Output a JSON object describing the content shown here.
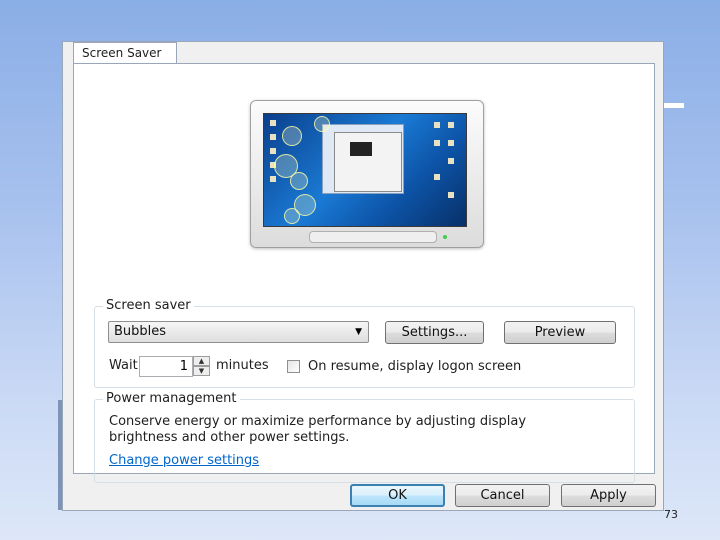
{
  "tab": {
    "label": "Screen Saver"
  },
  "screen_saver": {
    "group_title": "Screen saver",
    "selected": "Bubbles",
    "settings_label": "Settings...",
    "preview_label": "Preview",
    "wait_label": "Wait:",
    "wait_value": "1",
    "minutes_label": "minutes",
    "resume_label": "On resume, display logon screen",
    "resume_checked": false
  },
  "power": {
    "group_title": "Power management",
    "description_line1": "Conserve energy or maximize performance by adjusting display",
    "description_line2": "brightness and other power settings.",
    "link_label": "Change power settings"
  },
  "footer": {
    "ok_label": "OK",
    "cancel_label": "Cancel",
    "apply_label": "Apply"
  },
  "slide": {
    "page_number": "73"
  },
  "colors": {
    "accent": "#3c7fb1",
    "link": "#0066cc",
    "background": "#a9c2ee"
  },
  "icons": [
    "monitor-preview-icon",
    "chevron-down-icon",
    "spin-up-icon",
    "spin-down-icon"
  ]
}
